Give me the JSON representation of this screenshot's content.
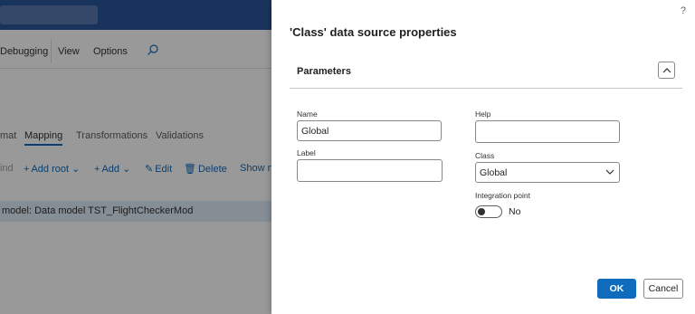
{
  "background": {
    "menu": {
      "debugging": "Debugging",
      "view": "View",
      "options": "Options"
    },
    "tabs": {
      "format": "mat",
      "mapping": "Mapping",
      "transformations": "Transformations",
      "validations": "Validations"
    },
    "actions": {
      "bind": "ind",
      "add_root": "Add root",
      "add": "Add",
      "edit": "Edit",
      "delete": "Delete",
      "show": "Show n"
    },
    "model_row": "model: Data model TST_FlightCheckerMod"
  },
  "panel": {
    "help": "?",
    "title": "'Class' data source properties",
    "section_title": "Parameters",
    "fields": {
      "name": {
        "label": "Name",
        "value": "Global"
      },
      "label": {
        "label": "Label",
        "value": ""
      },
      "help": {
        "label": "Help",
        "value": ""
      },
      "class": {
        "label": "Class",
        "value": "Global"
      },
      "integration_point": {
        "label": "Integration point",
        "value": "No"
      }
    },
    "buttons": {
      "ok": "OK",
      "cancel": "Cancel"
    }
  },
  "colors": {
    "accent": "#0f6cbd",
    "topbar": "#2b579a",
    "selected_row": "#deecf9"
  }
}
